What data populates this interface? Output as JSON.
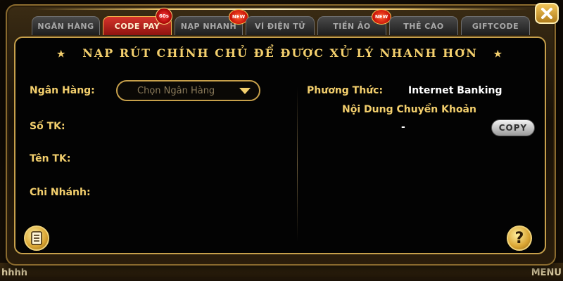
{
  "tabs": [
    {
      "label": "NGÂN HÀNG",
      "active": false
    },
    {
      "label": "CODE PAY",
      "active": true,
      "badge": "60s"
    },
    {
      "label": "NẠP NHANH",
      "active": false,
      "badge": "NEW"
    },
    {
      "label": "VÍ ĐIỆN TỬ",
      "active": false
    },
    {
      "label": "TIỀN ẢO",
      "active": false,
      "badge": "NEW"
    },
    {
      "label": "THẺ CÀO",
      "active": false
    },
    {
      "label": "GIFTCODE",
      "active": false
    }
  ],
  "panel": {
    "title": "NẠP RÚT CHÍNH CHỦ ĐỂ ĐƯỢC XỬ LÝ NHANH HƠN",
    "bank_label": "Ngân Hàng:",
    "bank_select_placeholder": "Chọn Ngân Hàng",
    "account_number_label": "Số TK:",
    "account_name_label": "Tên TK:",
    "branch_label": "Chi Nhánh:",
    "method_label": "Phương Thức:",
    "method_value": "Internet Banking",
    "transfer_content_label": "Nội Dung Chuyển Khoản",
    "transfer_content_value": "-",
    "copy_label": "COPY"
  },
  "bottom": {
    "left_text": "hhhh",
    "right_text": "MENU"
  },
  "colors": {
    "gold": "#f3cf6d",
    "active_tab": "#d6342c",
    "panel_bg": "#030303"
  },
  "icons": [
    "close-icon",
    "notes-icon",
    "help-icon",
    "star-icon",
    "chevron-down-icon"
  ]
}
